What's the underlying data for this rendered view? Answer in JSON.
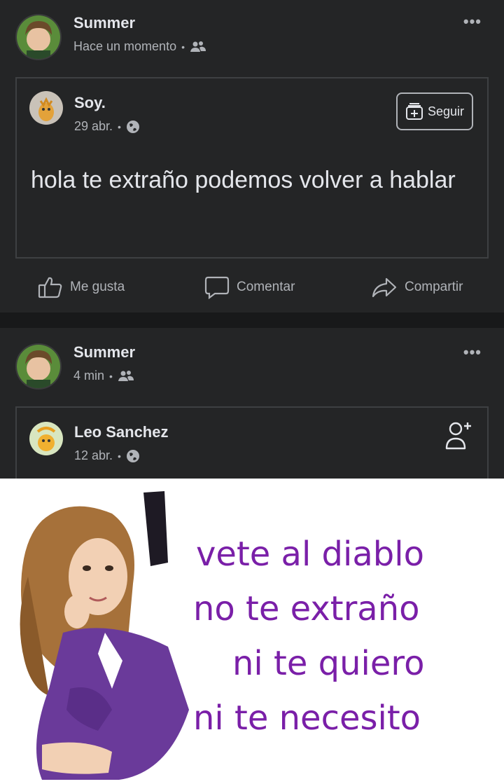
{
  "post1": {
    "author": "Summer",
    "time": "Hace un momento",
    "audience_icon": "friends-icon",
    "shared": {
      "author": "Soy.",
      "time": "29 abr.",
      "audience_icon": "globe-icon",
      "follow_label": "Seguir",
      "text": "hola te extraño podemos volver a hablar"
    },
    "actions": {
      "like": "Me gusta",
      "comment": "Comentar",
      "share": "Compartir"
    }
  },
  "post2": {
    "author": "Summer",
    "time": "4 min",
    "audience_icon": "friends-icon",
    "shared": {
      "author": "Leo Sanchez",
      "time": "12 abr.",
      "audience_icon": "globe-icon"
    },
    "meme": {
      "lines": [
        "vete al diablo",
        "no te extraño",
        "ni te quiero",
        "ni te necesito"
      ]
    }
  },
  "colors": {
    "background": "#18191a",
    "card": "#242526",
    "text_primary": "#e4e6eb",
    "text_secondary": "#b0b3b8",
    "meme_text": "#7a1fa8"
  }
}
